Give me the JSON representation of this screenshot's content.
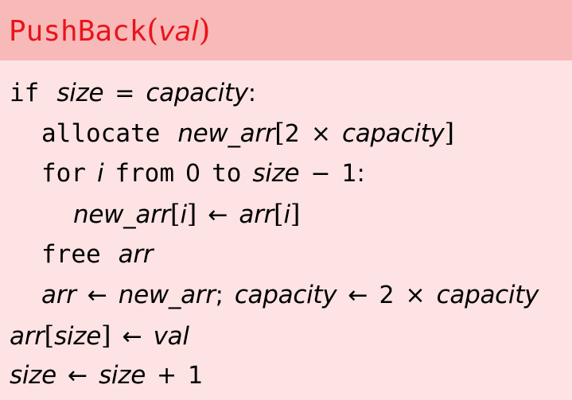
{
  "header": {
    "func_name": "PushBack",
    "open_paren": "(",
    "param": "val",
    "close_paren": ")"
  },
  "code": {
    "l1": {
      "kw_if": "if",
      "size": "size",
      "eq": "=",
      "capacity": "capacity",
      "colon": ":"
    },
    "l2": {
      "kw_allocate": "allocate",
      "new_arr": "new_arr",
      "lbr": "[",
      "two": "2",
      "times": "×",
      "capacity": "capacity",
      "rbr": "]"
    },
    "l3": {
      "kw_for": "for",
      "i": "i",
      "kw_from": "from",
      "zero": "0",
      "kw_to": "to",
      "size": "size",
      "minus": "−",
      "one": "1",
      "colon": ":"
    },
    "l4": {
      "new_arr": "new_arr",
      "lbr": "[",
      "i": "i",
      "rbr": "]",
      "arrow": "←",
      "arr": "arr",
      "lbr2": "[",
      "i2": "i",
      "rbr2": "]"
    },
    "l5": {
      "kw_free": "free",
      "arr": "arr"
    },
    "l6": {
      "arr": "arr",
      "arrow": "←",
      "new_arr": "new_arr",
      "semi": ";",
      "capacity": "capacity",
      "arrow2": "←",
      "two": "2",
      "times": "×",
      "capacity2": "capacity"
    },
    "l7": {
      "arr": "arr",
      "lbr": "[",
      "size": "size",
      "rbr": "]",
      "arrow": "←",
      "val": "val"
    },
    "l8": {
      "size": "size",
      "arrow": "←",
      "size2": "size",
      "plus": "+",
      "one": "1"
    }
  },
  "colors": {
    "header_bg": "#f8b9b9",
    "body_bg": "#fde3e3",
    "title_color": "#e8141b",
    "text_color": "#000000"
  }
}
